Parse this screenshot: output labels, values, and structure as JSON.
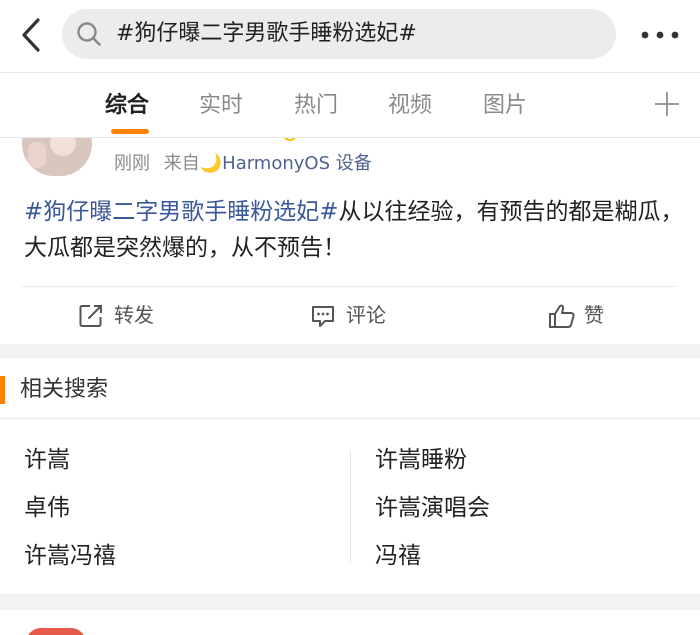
{
  "topbar": {
    "back_icon": "chevron-left-icon",
    "search_query": "#狗仔曝二字男歌手睡粉选妃#",
    "search_icon": "search-icon",
    "more_icon": "more-horizontal-icon"
  },
  "tabs": {
    "items": [
      {
        "label": "综合",
        "active": true
      },
      {
        "label": "实时",
        "active": false
      },
      {
        "label": "热门",
        "active": false
      },
      {
        "label": "视频",
        "active": false
      },
      {
        "label": "图片",
        "active": false
      }
    ],
    "add_icon": "plus-icon",
    "accent": "#ff8200"
  },
  "post": {
    "time": "刚刚",
    "source_prefix": "来自",
    "source_icon": "🌙",
    "source": "HarmonyOS 设备",
    "hashtag": "#狗仔曝二字男歌手睡粉选妃#",
    "text": "从以往经验，有预告的都是糊瓜，大瓜都是突然爆的，从不预告！",
    "actions": {
      "repost": {
        "label": "转发",
        "icon": "repost-icon"
      },
      "comment": {
        "label": "评论",
        "icon": "comment-icon"
      },
      "like": {
        "label": "赞",
        "icon": "thumbs-up-icon"
      }
    },
    "link_color": "#3b5998"
  },
  "related": {
    "title": "相关搜索",
    "left": [
      "许嵩",
      "卓伟",
      "许嵩冯禧"
    ],
    "right": [
      "许嵩睡粉",
      "许嵩演唱会",
      "冯禧"
    ]
  }
}
